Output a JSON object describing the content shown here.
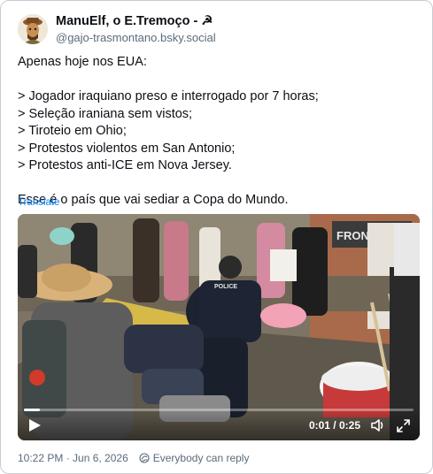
{
  "author": {
    "display_name": "ManuElf, o E.Tremoço - ☭",
    "handle": "@gajo-trasmontano.bsky.social",
    "avatar_icon": "avatar-illustration-icon"
  },
  "post": {
    "lines": [
      "Apenas hoje nos EUA:",
      "",
      "> Jogador iraquiano preso e interrogado por 7 horas;",
      "> Seleção iraniana sem vistos;",
      "> Tiroteio em Ohio;",
      "> Protestos violentos em San Antonio;",
      "> Protestos anti-ICE em Nova Jersey.",
      "",
      "Esse é o país que vai sediar a Copa do Mundo."
    ],
    "translate_label": "Translate"
  },
  "video": {
    "time": "0:01 / 0:25",
    "progress": 0.04,
    "police_label": "POLICE",
    "banner_text": "FRONTERAS",
    "play_icon": "play-icon",
    "volume_icon": "volume-icon",
    "fullscreen_icon": "fullscreen-icon"
  },
  "meta": {
    "timestamp": "10:22 PM · Jun 6, 2026",
    "reply_setting": "Everybody can reply",
    "reply_icon": "globe-reply-icon"
  },
  "colors": {
    "link": "#1083fe",
    "secondary_text": "#5b6b7b",
    "border": "#c9ccd1"
  }
}
